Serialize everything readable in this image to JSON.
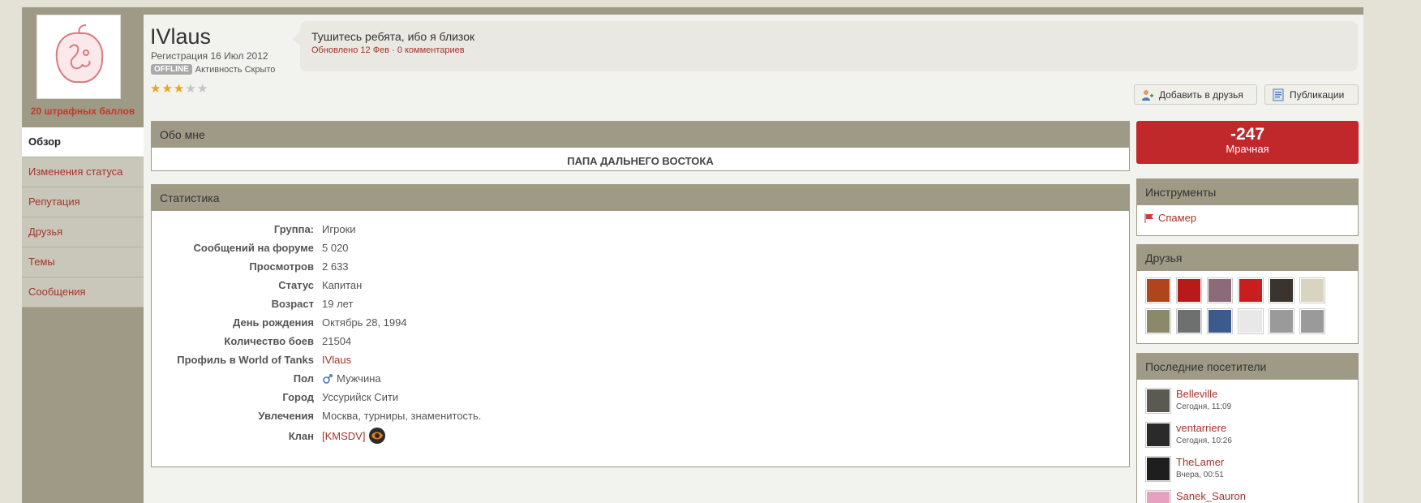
{
  "profile": {
    "username": "IVlaus",
    "registered": "Регистрация 16 Июл 2012",
    "offline_badge": "OFFLINE",
    "activity": "Активность Скрыто",
    "penalty": "20 штрафных баллов",
    "rating_stars": 3,
    "rating_max": 5
  },
  "status": {
    "text": "Тушитесь ребята, ибо я близок",
    "meta": "Обновлено 12 Фев · 0 комментариев"
  },
  "buttons": {
    "add_friend": "Добавить в друзья",
    "publications": "Публикации"
  },
  "sidebar": {
    "tabs": [
      {
        "label": "Обзор",
        "active": true
      },
      {
        "label": "Изменения статуса",
        "active": false
      },
      {
        "label": "Репутация",
        "active": false
      },
      {
        "label": "Друзья",
        "active": false
      },
      {
        "label": "Темы",
        "active": false
      },
      {
        "label": "Сообщения",
        "active": false
      }
    ]
  },
  "about": {
    "title": "Обо мне",
    "text": "ПАПА ДАЛЬНЕГО ВОСТОКА"
  },
  "stats": {
    "title": "Статистика",
    "rows": [
      {
        "label": "Группа:",
        "value": "Игроки"
      },
      {
        "label": "Сообщений на форуме",
        "value": "5  020"
      },
      {
        "label": "Просмотров",
        "value": "2  633"
      },
      {
        "label": "Статус",
        "value": "Капитан"
      },
      {
        "label": "Возраст",
        "value": "19 лет"
      },
      {
        "label": "День рождения",
        "value": "Октябрь 28, 1994"
      },
      {
        "label": "Количество боев",
        "value": "21504"
      },
      {
        "label": "Профиль в World of Tanks",
        "value": "IVlaus"
      },
      {
        "label": "Пол",
        "value": "Мужчина"
      },
      {
        "label": "Город",
        "value": "Уссурийск Сити"
      },
      {
        "label": "Увлечения",
        "value": "Москва, турниры, знаменитость."
      },
      {
        "label": "Клан",
        "value": "[KMSDV]"
      }
    ]
  },
  "reputation": {
    "value": "-247",
    "label": "Мрачная",
    "color": "#c0282c"
  },
  "tools": {
    "title": "Инструменты",
    "spammer": "Спамер"
  },
  "friends": {
    "title": "Друзья",
    "avatar_colors": [
      "#b0441c",
      "#b81a1a",
      "#8b6a7a",
      "#c81e1e",
      "#3a332e",
      "#d9d4c0",
      "#8a8a6a",
      "#6e7070",
      "#3c5a8c",
      "#e8e8e8",
      "#9a9a9a",
      "#9a9a9a"
    ]
  },
  "visitors": {
    "title": "Последние посетители",
    "items": [
      {
        "name": "Belleville",
        "time": "Сегодня, 11:09",
        "color": "#5a5a50"
      },
      {
        "name": "ventarriere",
        "time": "Сегодня, 10:26",
        "color": "#2a2a2a"
      },
      {
        "name": "TheLamer",
        "time": "Вчера, 00:51",
        "color": "#1e1e1e"
      },
      {
        "name": "Sanek_Sauron",
        "time": "",
        "color": "#e8a0c0"
      }
    ]
  },
  "colors": {
    "accent": "#a6332a",
    "header_bg": "#9e9a85",
    "page_bg": "#e4e2d6"
  }
}
